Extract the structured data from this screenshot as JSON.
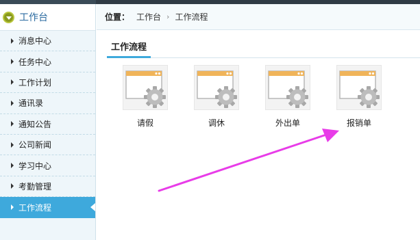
{
  "sidebar": {
    "header_title": "工作台",
    "items": [
      {
        "label": "消息中心"
      },
      {
        "label": "任务中心"
      },
      {
        "label": "工作计划"
      },
      {
        "label": "通讯录"
      },
      {
        "label": "通知公告"
      },
      {
        "label": "公司新闻"
      },
      {
        "label": "学习中心"
      },
      {
        "label": "考勤管理"
      },
      {
        "label": "工作流程",
        "active": true
      }
    ]
  },
  "breadcrumb": {
    "prefix": "位置：",
    "items": [
      "工作台",
      "工作流程"
    ],
    "separator": "›"
  },
  "section": {
    "tab_label": "工作流程"
  },
  "workflows": [
    {
      "label": "请假",
      "icon": "window-gear-icon"
    },
    {
      "label": "调休",
      "icon": "window-gear-icon"
    },
    {
      "label": "外出单",
      "icon": "window-gear-icon"
    },
    {
      "label": "报销单",
      "icon": "window-gear-icon"
    }
  ],
  "colors": {
    "accent": "#3ea9dc",
    "annotation_arrow": "#e83ce8",
    "sidebar_bg": "#eef6fa"
  }
}
